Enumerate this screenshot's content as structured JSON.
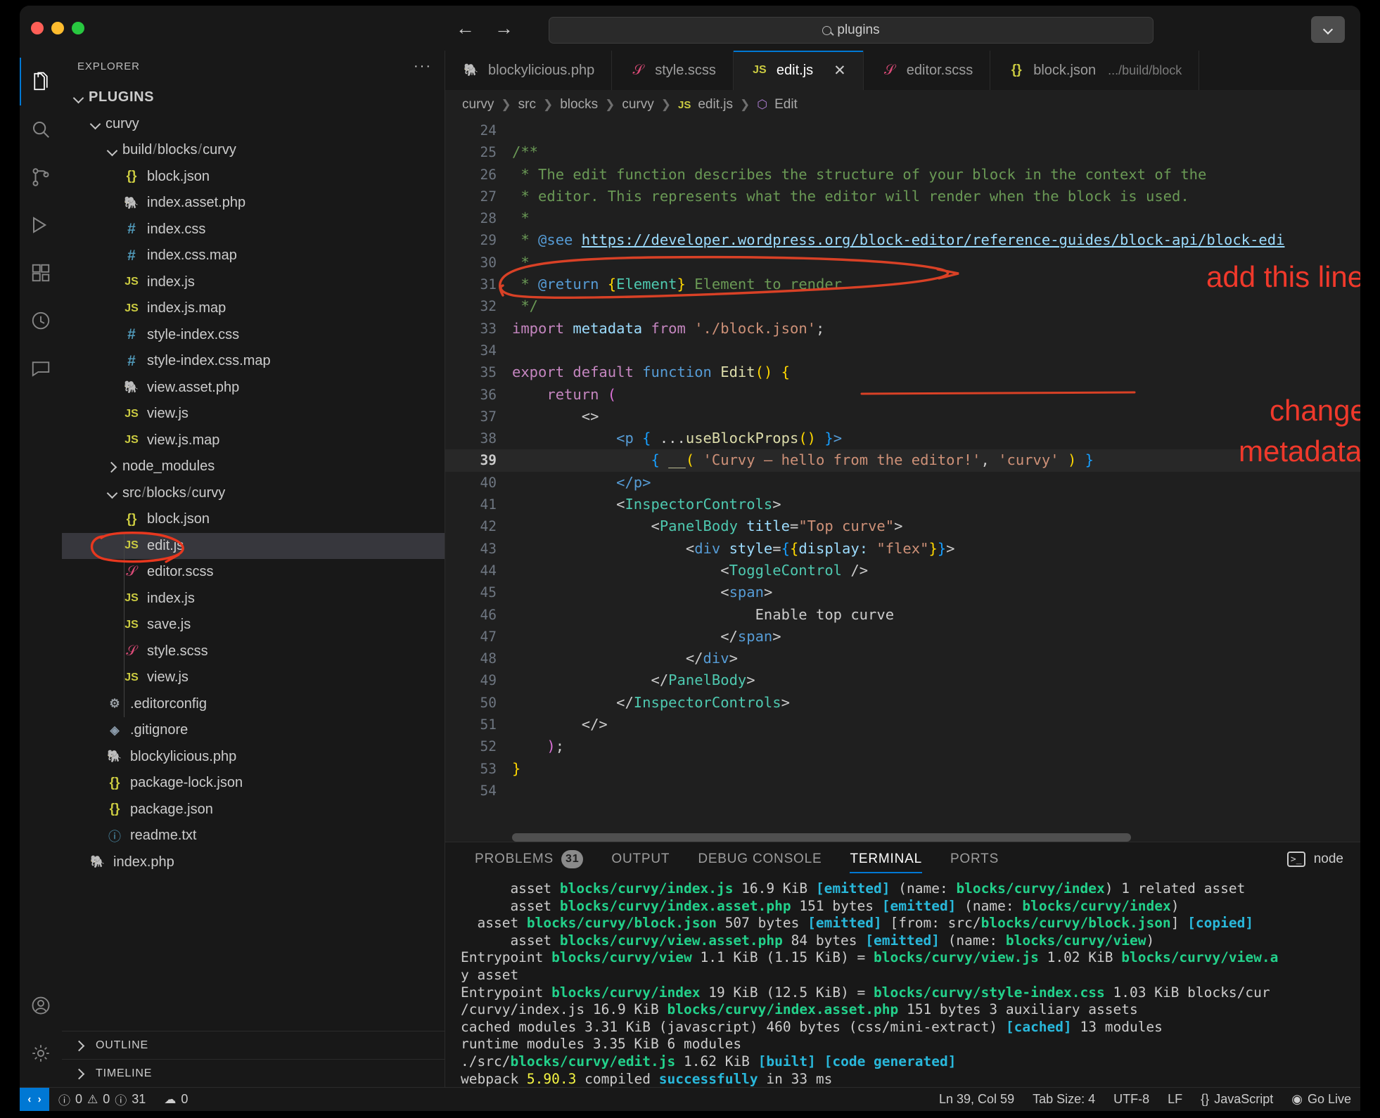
{
  "titlebar": {
    "back_label": "←",
    "forward_label": "→",
    "quick_open_value": "plugins",
    "search_icon": "search-icon",
    "layout_icon": "chevron-down-icon"
  },
  "activity_bar": {
    "items": [
      {
        "name": "explorer",
        "icon": "files-icon",
        "active": true
      },
      {
        "name": "search",
        "icon": "search-icon",
        "active": false
      },
      {
        "name": "source-control",
        "icon": "source-control-icon",
        "active": false
      },
      {
        "name": "run-and-debug",
        "icon": "run-debug-icon",
        "active": false
      },
      {
        "name": "extensions",
        "icon": "extensions-icon",
        "active": false
      },
      {
        "name": "testing",
        "icon": "beaker-icon",
        "active": false
      },
      {
        "name": "comments",
        "icon": "comment-icon",
        "active": false
      },
      {
        "name": "accounts",
        "icon": "account-icon",
        "active": false
      },
      {
        "name": "manage",
        "icon": "gear-icon",
        "active": false
      }
    ]
  },
  "sidebar": {
    "header": "EXPLORER",
    "more_label": "···",
    "tree": [
      {
        "label": "PLUGINS",
        "kind": "root",
        "depth": 0,
        "expanded": true
      },
      {
        "label": "curvy",
        "kind": "folder",
        "depth": 1,
        "expanded": true
      },
      {
        "label": "build/blocks/curvy",
        "kind": "folder-path",
        "depth": 2,
        "expanded": true
      },
      {
        "label": "block.json",
        "kind": "json",
        "depth": 3
      },
      {
        "label": "index.asset.php",
        "kind": "php",
        "depth": 3
      },
      {
        "label": "index.css",
        "kind": "css",
        "depth": 3
      },
      {
        "label": "index.css.map",
        "kind": "css",
        "depth": 3
      },
      {
        "label": "index.js",
        "kind": "js",
        "depth": 3
      },
      {
        "label": "index.js.map",
        "kind": "js",
        "depth": 3
      },
      {
        "label": "style-index.css",
        "kind": "css",
        "depth": 3
      },
      {
        "label": "style-index.css.map",
        "kind": "css",
        "depth": 3
      },
      {
        "label": "view.asset.php",
        "kind": "php",
        "depth": 3
      },
      {
        "label": "view.js",
        "kind": "js",
        "depth": 3
      },
      {
        "label": "view.js.map",
        "kind": "js",
        "depth": 3
      },
      {
        "label": "node_modules",
        "kind": "folder",
        "depth": 2,
        "expanded": false
      },
      {
        "label": "src/blocks/curvy",
        "kind": "folder-path",
        "depth": 2,
        "expanded": true
      },
      {
        "label": "block.json",
        "kind": "json",
        "depth": 3
      },
      {
        "label": "edit.js",
        "kind": "js",
        "depth": 3,
        "selected": true
      },
      {
        "label": "editor.scss",
        "kind": "scss",
        "depth": 3
      },
      {
        "label": "index.js",
        "kind": "js",
        "depth": 3
      },
      {
        "label": "save.js",
        "kind": "js",
        "depth": 3
      },
      {
        "label": "style.scss",
        "kind": "scss",
        "depth": 3
      },
      {
        "label": "view.js",
        "kind": "js",
        "depth": 3
      },
      {
        "label": ".editorconfig",
        "kind": "gear",
        "depth": 2
      },
      {
        "label": ".gitignore",
        "kind": "git",
        "depth": 2
      },
      {
        "label": "blockylicious.php",
        "kind": "php",
        "depth": 2
      },
      {
        "label": "package-lock.json",
        "kind": "json",
        "depth": 2
      },
      {
        "label": "package.json",
        "kind": "json",
        "depth": 2
      },
      {
        "label": "readme.txt",
        "kind": "txt",
        "depth": 2
      },
      {
        "label": "index.php",
        "kind": "php",
        "depth": 1
      }
    ],
    "footer": [
      {
        "label": "OUTLINE",
        "expanded": false
      },
      {
        "label": "TIMELINE",
        "expanded": false
      }
    ]
  },
  "editor": {
    "tabs": [
      {
        "label": "blockylicious.php",
        "icon": "php-icon",
        "active": false,
        "dirty": false
      },
      {
        "label": "style.scss",
        "icon": "scss-icon",
        "active": false
      },
      {
        "label": "edit.js",
        "icon": "js-icon",
        "active": true,
        "close_label": "✕"
      },
      {
        "label": "editor.scss",
        "icon": "scss-icon",
        "active": false
      },
      {
        "label": "block.json",
        "icon": "json-icon",
        "active": false,
        "sublabel": ".../build/block"
      }
    ],
    "breadcrumb": [
      "curvy",
      "src",
      "blocks",
      "curvy",
      "edit.js",
      "Edit"
    ],
    "first_line": 24,
    "code_lines": [
      {
        "n": 24,
        "text": ""
      },
      {
        "n": 25,
        "text": "/**"
      },
      {
        "n": 26,
        "text": " * The edit function describes the structure of your block in the context of the"
      },
      {
        "n": 27,
        "text": " * editor. This represents what the editor will render when the block is used."
      },
      {
        "n": 28,
        "text": " *"
      },
      {
        "n": 29,
        "text": " * @see https://developer.wordpress.org/block-editor/reference-guides/block-api/block-edi"
      },
      {
        "n": 30,
        "text": " *"
      },
      {
        "n": 31,
        "text": " * @return {Element} Element to render."
      },
      {
        "n": 32,
        "text": " */"
      },
      {
        "n": 33,
        "text": "import metadata from './block.json';"
      },
      {
        "n": 34,
        "text": ""
      },
      {
        "n": 35,
        "text": "export default function Edit() {"
      },
      {
        "n": 36,
        "text": "    return ("
      },
      {
        "n": 37,
        "text": "        <>"
      },
      {
        "n": 38,
        "text": "            <p { ...useBlockProps() }>"
      },
      {
        "n": 39,
        "text": "                { __( 'Curvy – hello from the editor!', 'curvy' ) }",
        "current": true
      },
      {
        "n": 40,
        "text": "            </p>"
      },
      {
        "n": 41,
        "text": "            <InspectorControls>"
      },
      {
        "n": 42,
        "text": "                <PanelBody title=\"Top curve\">"
      },
      {
        "n": 43,
        "text": "                    <div style={{display: \"flex\"}}>"
      },
      {
        "n": 44,
        "text": "                        <ToggleControl />"
      },
      {
        "n": 45,
        "text": "                        <span>"
      },
      {
        "n": 46,
        "text": "                            Enable top curve"
      },
      {
        "n": 47,
        "text": "                        </span>"
      },
      {
        "n": 48,
        "text": "                    </div>"
      },
      {
        "n": 49,
        "text": "                </PanelBody>"
      },
      {
        "n": 50,
        "text": "            </InspectorControls>"
      },
      {
        "n": 51,
        "text": "        </>"
      },
      {
        "n": 52,
        "text": "    );"
      },
      {
        "n": 53,
        "text": "}"
      },
      {
        "n": 54,
        "text": ""
      }
    ]
  },
  "annotations": [
    {
      "name": "add-this-line-note",
      "text": "add this line",
      "color": "#f0392b"
    },
    {
      "name": "change-curvy-note-line1",
      "text": "change 'curvy' to",
      "color": "#f0392b"
    },
    {
      "name": "change-curvy-note-line2",
      "text": "metadata.textdomain",
      "color": "#f0392b"
    }
  ],
  "panel": {
    "tabs": [
      {
        "label": "PROBLEMS",
        "badge": "31",
        "active": false
      },
      {
        "label": "OUTPUT",
        "active": false
      },
      {
        "label": "DEBUG CONSOLE",
        "active": false
      },
      {
        "label": "TERMINAL",
        "active": true
      },
      {
        "label": "PORTS",
        "active": false
      }
    ],
    "terminal_selector": "node",
    "terminal_lines": [
      "      asset blocks/curvy/index.js 16.9 KiB [emitted] (name: blocks/curvy/index) 1 related asset",
      "      asset blocks/curvy/index.asset.php 151 bytes [emitted] (name: blocks/curvy/index)",
      "  asset blocks/curvy/block.json 507 bytes [emitted] [from: src/blocks/curvy/block.json] [copied]",
      "      asset blocks/curvy/view.asset.php 84 bytes [emitted] (name: blocks/curvy/view)",
      "Entrypoint blocks/curvy/view 1.1 KiB (1.15 KiB) = blocks/curvy/view.js 1.02 KiB blocks/curvy/view.a",
      "y asset",
      "Entrypoint blocks/curvy/index 19 KiB (12.5 KiB) = blocks/curvy/style-index.css 1.03 KiB blocks/cur",
      "/curvy/index.js 16.9 KiB blocks/curvy/index.asset.php 151 bytes 3 auxiliary assets",
      "cached modules 3.31 KiB (javascript) 460 bytes (css/mini-extract) [cached] 13 modules",
      "runtime modules 3.35 KiB 6 modules",
      "./src/blocks/curvy/edit.js 1.62 KiB [built] [code generated]",
      "webpack 5.90.3 compiled successfully in 33 ms"
    ]
  },
  "statusbar": {
    "remote_icon": "remote-indicator-icon",
    "errors": "0",
    "warnings": "0",
    "infos": "31",
    "radio_count": "0",
    "cursor": "Ln 39, Col 59",
    "tab_size": "Tab Size: 4",
    "encoding": "UTF-8",
    "eol": "LF",
    "language": "JavaScript",
    "go_live": "Go Live"
  }
}
